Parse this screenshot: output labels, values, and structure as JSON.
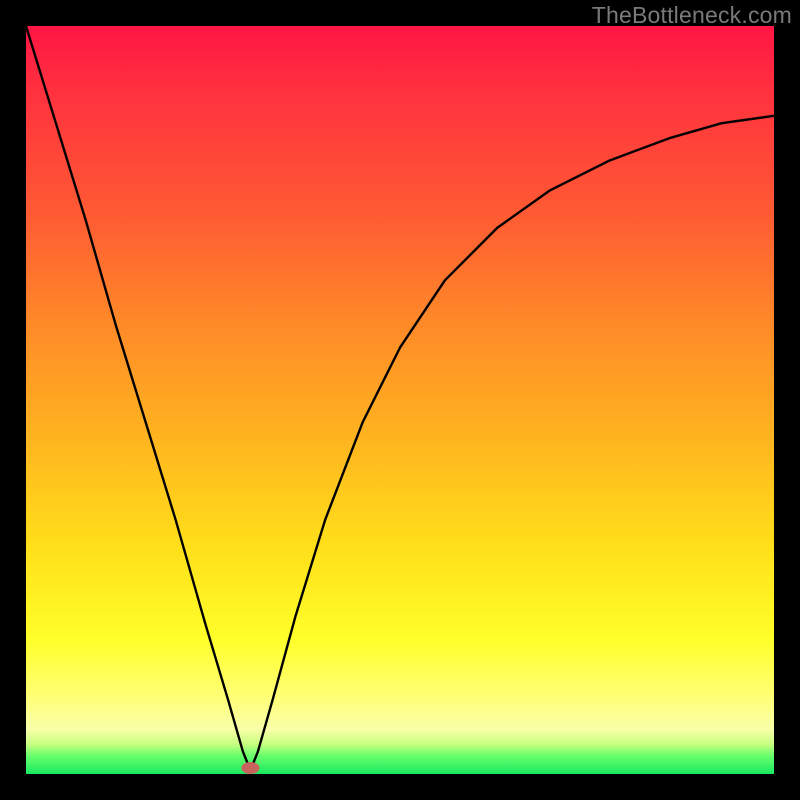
{
  "watermark": "TheBottleneck.com",
  "chart_data": {
    "type": "line",
    "title": "",
    "xlabel": "",
    "ylabel": "",
    "xlim": [
      0,
      1
    ],
    "ylim": [
      0,
      1
    ],
    "minimum": {
      "x": 0.3,
      "y": 0.005
    },
    "series": [
      {
        "name": "bottleneck-curve",
        "x": [
          0.0,
          0.04,
          0.08,
          0.12,
          0.16,
          0.2,
          0.24,
          0.27,
          0.29,
          0.3,
          0.31,
          0.33,
          0.36,
          0.4,
          0.45,
          0.5,
          0.56,
          0.63,
          0.7,
          0.78,
          0.86,
          0.93,
          1.0
        ],
        "values": [
          1.0,
          0.87,
          0.74,
          0.6,
          0.47,
          0.34,
          0.2,
          0.1,
          0.03,
          0.005,
          0.03,
          0.1,
          0.21,
          0.34,
          0.47,
          0.57,
          0.66,
          0.73,
          0.78,
          0.82,
          0.85,
          0.87,
          0.88
        ]
      }
    ],
    "gradient_stops": [
      {
        "pos": 0.0,
        "color": "#ff1544"
      },
      {
        "pos": 0.5,
        "color": "#ffb020"
      },
      {
        "pos": 0.85,
        "color": "#ffff40"
      },
      {
        "pos": 1.0,
        "color": "#18e860"
      }
    ]
  }
}
